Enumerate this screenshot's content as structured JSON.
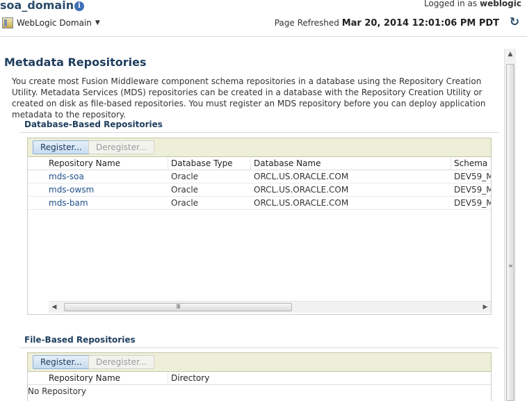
{
  "header": {
    "domain_title": "soa_domain",
    "info_icon": "info-icon",
    "logged_in_prefix": "Logged in as",
    "logged_in_user": "weblogic",
    "domain_menu_label": "WebLogic Domain",
    "refresh_prefix": "Page Refreshed",
    "refresh_timestamp": "Mar 20, 2014 12:01:06 PM PDT",
    "refresh_icon": "refresh-icon"
  },
  "main": {
    "title": "Metadata Repositories",
    "description": "You create most Fusion Middleware component schema repositories in a database using the Repository Creation Utility. Metadata Services (MDS) repositories can be created in a database with the Repository Creation Utility or created on disk as file-based repositories. You must register an MDS repository before you can deploy application metadata to the repository."
  },
  "db_repos": {
    "title": "Database-Based Repositories",
    "register_label": "Register...",
    "deregister_label": "Deregister...",
    "columns": [
      "Repository Name",
      "Database Type",
      "Database Name",
      "Schema N"
    ],
    "rows": [
      [
        "mds-soa",
        "Oracle",
        "ORCL.US.ORACLE.COM",
        "DEV59_M"
      ],
      [
        "mds-owsm",
        "Oracle",
        "ORCL.US.ORACLE.COM",
        "DEV59_M"
      ],
      [
        "mds-bam",
        "Oracle",
        "ORCL.US.ORACLE.COM",
        "DEV59_M"
      ]
    ],
    "scroll_thumb_glyph": "III"
  },
  "file_repos": {
    "title": "File-Based Repositories",
    "register_label": "Register...",
    "deregister_label": "Deregister...",
    "columns": [
      "Repository Name",
      "Directory"
    ],
    "empty_text": "No Repository"
  },
  "colors": {
    "title": "#1f3e5e",
    "link": "#1d4e89",
    "toolbar": "#eeefd8"
  }
}
